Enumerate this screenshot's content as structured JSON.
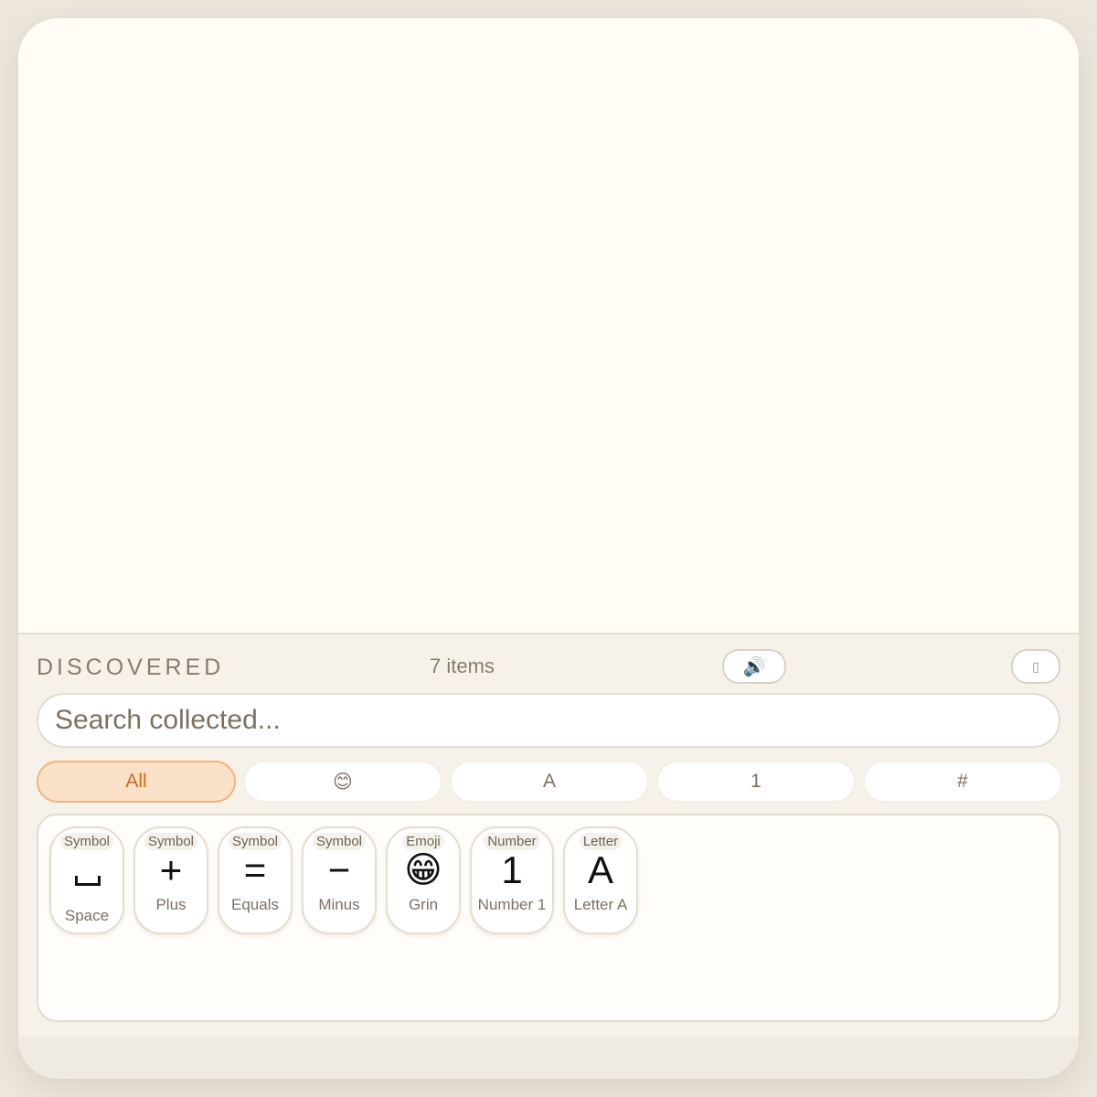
{
  "panel": {
    "title": "DISCOVERED",
    "count": "7 items",
    "sound_icon": "🔊",
    "close_icon": "▯"
  },
  "search": {
    "placeholder": "Search collected..."
  },
  "filters": [
    {
      "label": "All",
      "active": true
    },
    {
      "label": "😊",
      "active": false
    },
    {
      "label": "A",
      "active": false
    },
    {
      "label": "1",
      "active": false
    },
    {
      "label": "#",
      "active": false
    }
  ],
  "items": [
    {
      "category": "Symbol",
      "glyph": "␣",
      "name": "Space"
    },
    {
      "category": "Symbol",
      "glyph": "+",
      "name": "Plus"
    },
    {
      "category": "Symbol",
      "glyph": "=",
      "name": "Equals"
    },
    {
      "category": "Symbol",
      "glyph": "−",
      "name": "Minus"
    },
    {
      "category": "Emoji",
      "glyph": "😁",
      "name": "Grin"
    },
    {
      "category": "Number",
      "glyph": "1",
      "name": "Number 1"
    },
    {
      "category": "Letter",
      "glyph": "A",
      "name": "Letter A"
    }
  ],
  "colors": {
    "accent": "#f3b47c",
    "accent_text": "#c96a1b",
    "background": "#fffdf6"
  }
}
